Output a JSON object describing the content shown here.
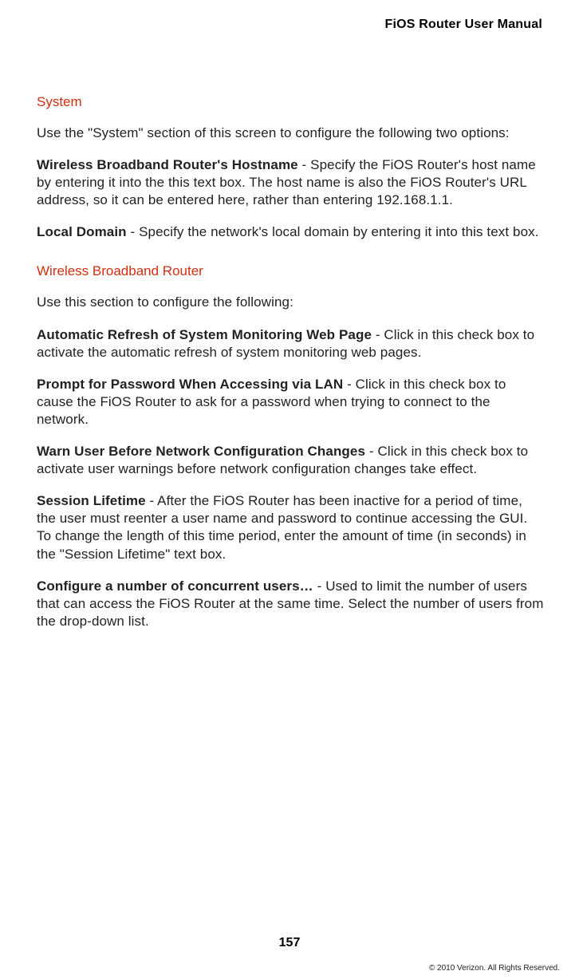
{
  "header": {
    "manual_title": "FiOS Router User Manual"
  },
  "sections": {
    "system": {
      "heading": "System",
      "intro": "Use the \"System\" section of this screen to configure the following two options:",
      "hostname_bold": "Wireless Broadband Router's Hostname",
      "hostname_rest": " - Specify the FiOS Router's host name by entering it into the this text box. The host name is also the FiOS Router's URL address, so it can be entered here, rather than entering 192.168.1.1.",
      "local_domain_bold": "Local Domain",
      "local_domain_rest": " - Specify the network's local domain by entering it into this text box."
    },
    "wbr": {
      "heading": "Wireless Broadband Router",
      "intro": "Use this section to configure the following:",
      "auto_refresh_bold": "Automatic Refresh of System Monitoring Web Page",
      "auto_refresh_rest": " - Click in this check box to activate the automatic refresh of system monitoring web pages.",
      "prompt_pw_bold": "Prompt for Password When Accessing via LAN",
      "prompt_pw_rest": " - Click in this check box to cause the FiOS Router to ask for a password when trying to connect to the network.",
      "warn_bold": "Warn User Before Network Configuration Changes",
      "warn_rest": " - Click in this check box to activate user warnings before network configuration changes take effect.",
      "session_bold": "Session Lifetime",
      "session_rest": " - After the FiOS Router has been inactive for a period of time, the user must reenter a user name and password to continue accessing the GUI. To change the length of this time period, enter the amount of time (in seconds) in the \"Session Lifetime\" text box.",
      "concurrent_bold": "Configure a number of concurrent users…",
      "concurrent_rest": " - Used to limit the number of users that can access the FiOS Router at the same time. Select the number of users from the drop-down list."
    }
  },
  "footer": {
    "page_number": "157",
    "copyright": "© 2010 Verizon. All Rights Reserved."
  }
}
